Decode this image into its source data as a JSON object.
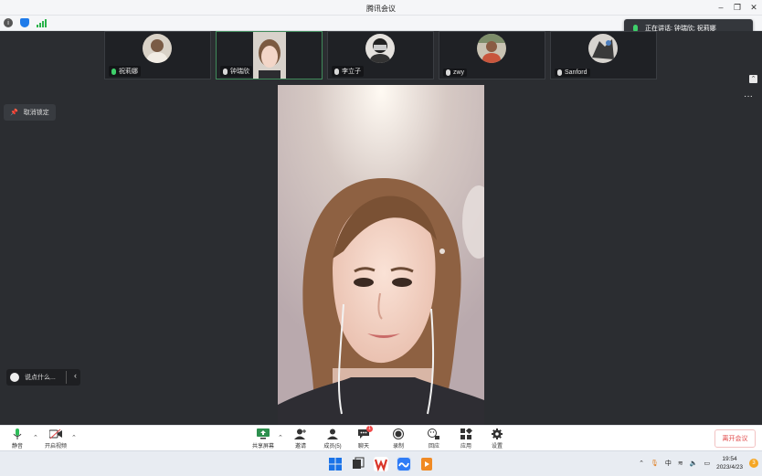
{
  "window": {
    "title": "腾讯会议",
    "controls": [
      "minimize",
      "restore",
      "close"
    ]
  },
  "speaking": {
    "label": "正在讲话: 钟瑞欣; 祝莉娜"
  },
  "participants": [
    {
      "name": "祝莉娜",
      "mic": "on",
      "type": "avatar"
    },
    {
      "name": "钟瑞欣",
      "mic": "on",
      "type": "video",
      "active": true
    },
    {
      "name": "李立子",
      "mic": "muted",
      "type": "avatar"
    },
    {
      "name": "zwy",
      "mic": "muted",
      "type": "avatar"
    },
    {
      "name": "Sanford",
      "mic": "muted",
      "type": "avatar"
    }
  ],
  "stage": {
    "unpin_label": "取消锁定",
    "more_label": "···",
    "chat_placeholder": "说点什么..."
  },
  "toolbar": {
    "mute_label": "静音",
    "video_label": "开启视频",
    "share_label": "共享屏幕",
    "invite_label": "邀请",
    "members_label": "成员(5)",
    "chat_label": "聊天",
    "chat_badge": "1",
    "record_label": "录制",
    "reactions_label": "回应",
    "apps_label": "应用",
    "settings_label": "设置",
    "leave_label": "离开会议"
  },
  "taskbar": {
    "ime": "中",
    "time": "19:54",
    "date": "2023/4/23",
    "notifications": "3"
  },
  "colors": {
    "stage_bg": "#2b2d31",
    "mic_active": "#3ecf6a",
    "leave_red": "#e24a4a",
    "brand_blue": "#1e7bea"
  }
}
